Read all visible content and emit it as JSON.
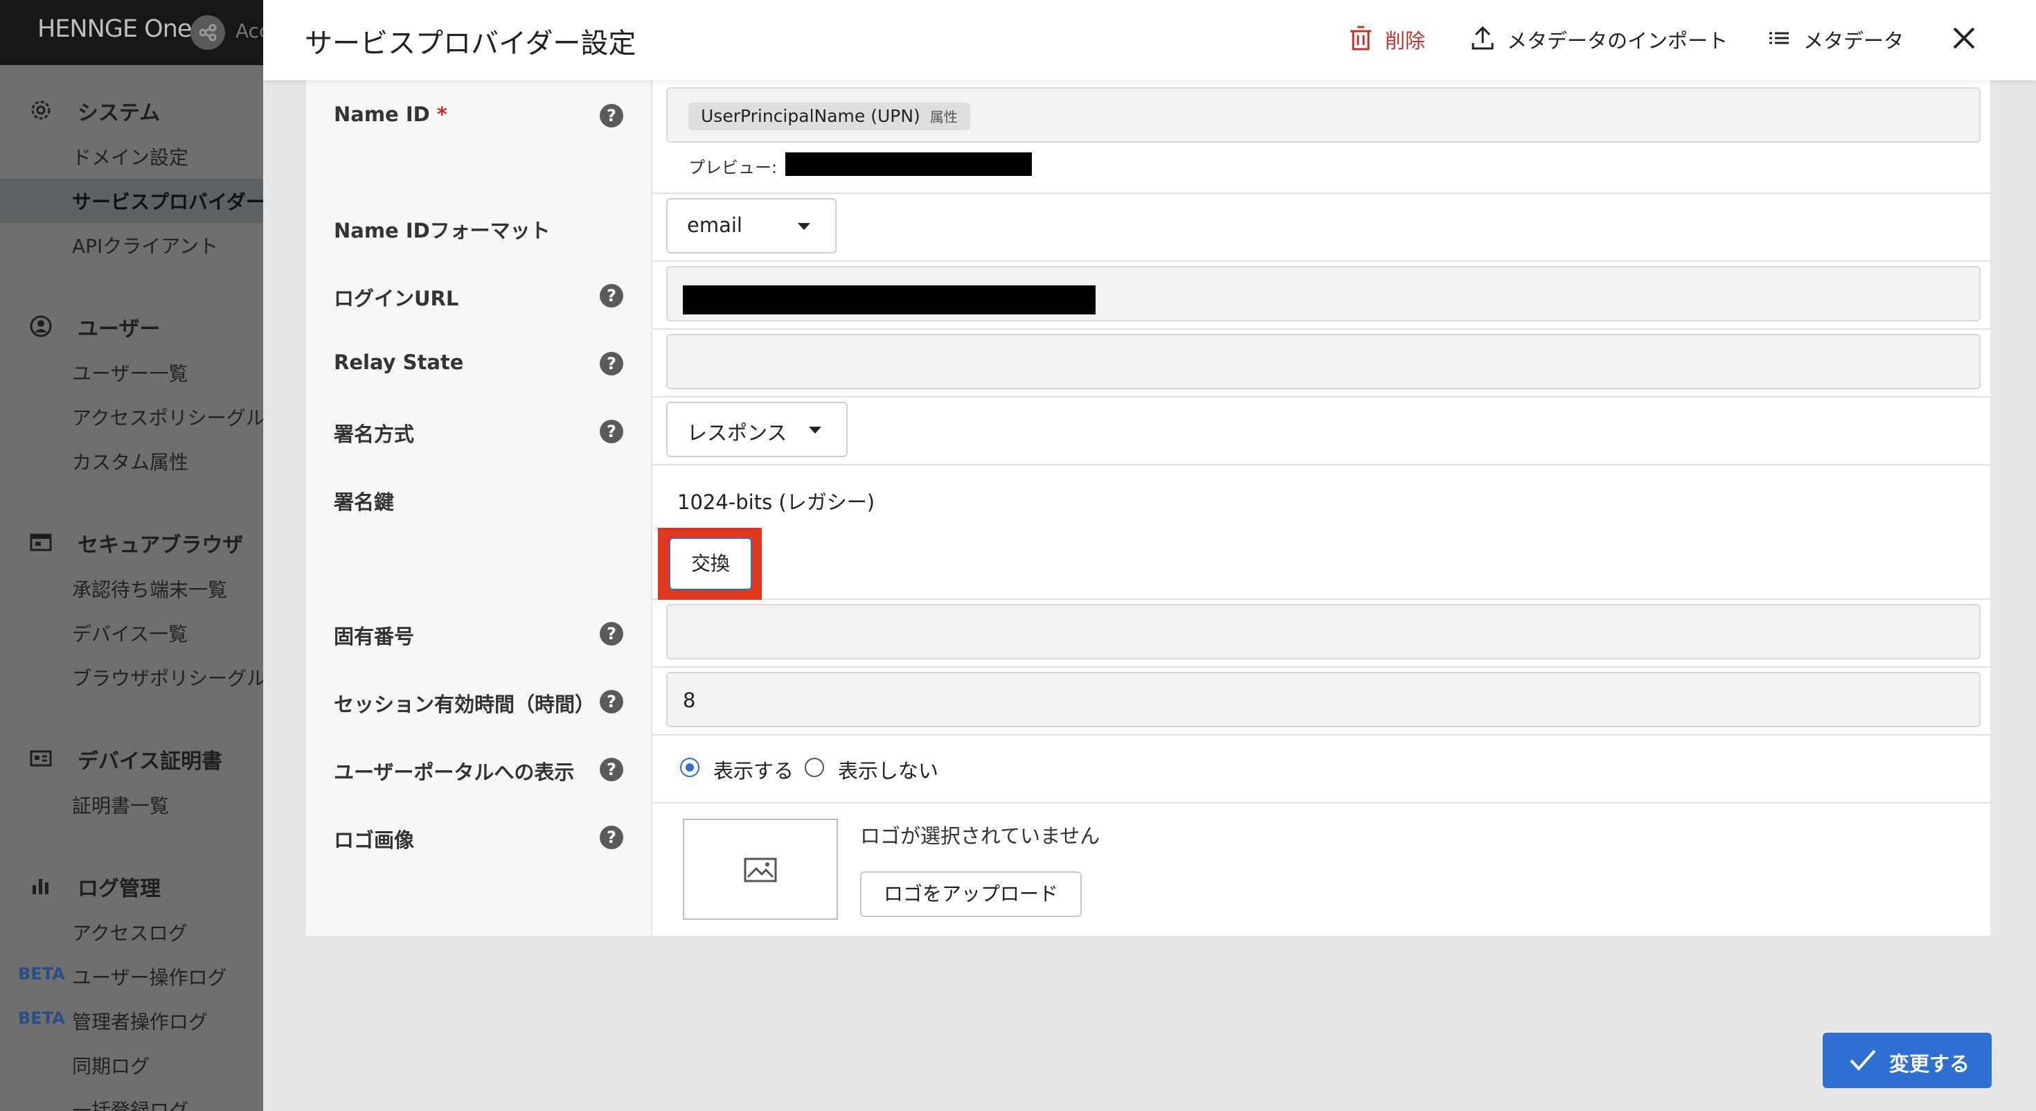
{
  "sidebar": {
    "brand": "HENNGE One",
    "brand_sub": "Acc",
    "sections": [
      {
        "title": "システム",
        "icon": "gear-icon",
        "items": [
          "ドメイン設定",
          "サービスプロバイダー",
          "APIクライアント"
        ]
      },
      {
        "title": "ユーザー",
        "icon": "user-circle-icon",
        "items": [
          "ユーザー一覧",
          "アクセスポリシーグル",
          "カスタム属性"
        ]
      },
      {
        "title": "セキュアブラウザ",
        "icon": "browser-icon",
        "items": [
          "承認待ち端末一覧",
          "デバイス一覧",
          "ブラウザポリシーグル"
        ]
      },
      {
        "title": "デバイス証明書",
        "icon": "certificate-icon",
        "items": [
          "証明書一覧"
        ]
      },
      {
        "title": "ログ管理",
        "icon": "bar-chart-icon",
        "items": [
          "アクセスログ",
          "ユーザー操作ログ",
          "管理者操作ログ",
          "同期ログ",
          "一括登録ログ"
        ]
      }
    ],
    "active_item": "サービスプロバイダー",
    "beta_label": "BETA"
  },
  "header": {
    "title": "サービスプロバイダー設定",
    "delete_label": "削除",
    "import_label": "メタデータのインポート",
    "metadata_label": "メタデータ",
    "colors": {
      "delete": "#c0332d"
    }
  },
  "form": {
    "name_id": {
      "label": "Name ID",
      "required_mark": "*",
      "chip": "UserPrincipalName (UPN)",
      "chip_tag": "属性",
      "preview_label": "プレビュー:"
    },
    "name_id_format": {
      "label": "Name IDフォーマット",
      "value": "email"
    },
    "login_url": {
      "label": "ログインURL"
    },
    "relay_state": {
      "label": "Relay State",
      "value": ""
    },
    "signing_method": {
      "label": "署名方式",
      "value": "レスポンス"
    },
    "signing_key": {
      "label": "署名鍵",
      "value": "1024-bits (レガシー)",
      "button": "交換"
    },
    "unique_number": {
      "label": "固有番号",
      "value": ""
    },
    "session_hours": {
      "label": "セッション有効時間（時間）",
      "value": "8"
    },
    "portal_display": {
      "label": "ユーザーポータルへの表示",
      "options": [
        "表示する",
        "表示しない"
      ],
      "selected": "表示する"
    },
    "logo": {
      "label": "ロゴ画像",
      "status": "ロゴが選択されていません",
      "upload_button": "ロゴをアップロード"
    },
    "help_glyph": "?"
  },
  "footer": {
    "submit_label": "変更する",
    "colors": {
      "accent": "#2f6fd1"
    }
  },
  "highlight": {
    "color": "#e0381f"
  }
}
